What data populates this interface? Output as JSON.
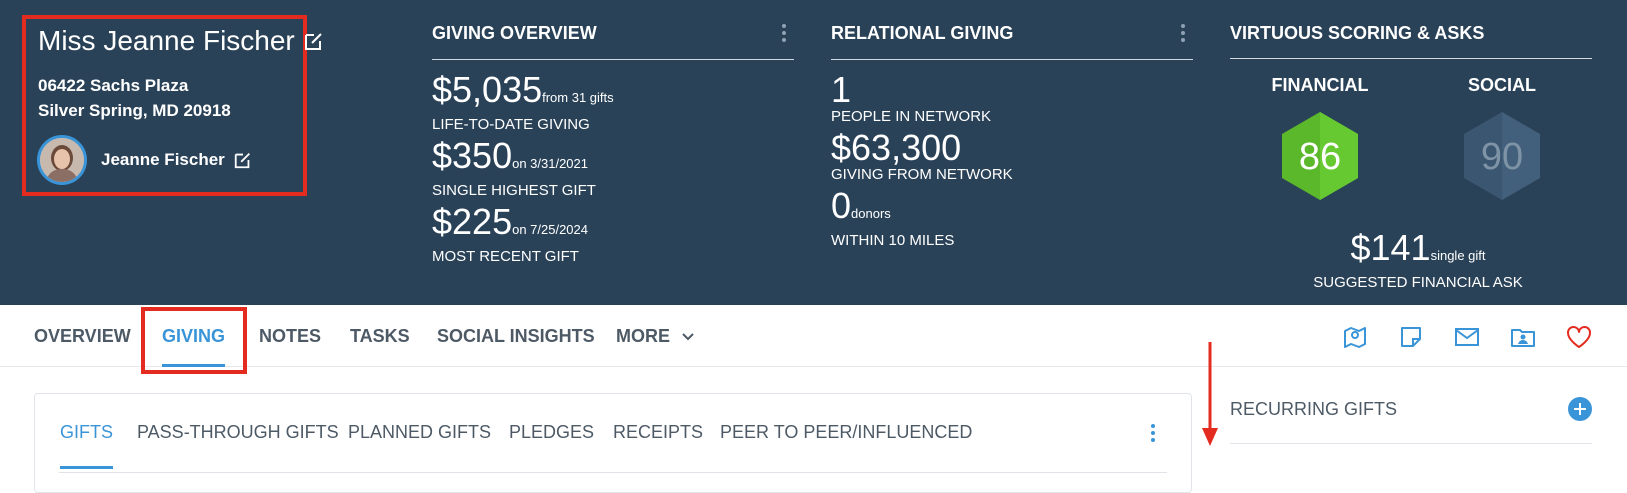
{
  "contact": {
    "name": "Miss Jeanne Fischer",
    "address_line1": "06422 Sachs Plaza",
    "address_line2": "Silver Spring, MD 20918",
    "person_name": "Jeanne Fischer"
  },
  "giving_overview": {
    "title": "GIVING OVERVIEW",
    "lifetime_value": "$5,035",
    "lifetime_note": "from 31 gifts",
    "lifetime_label": "LIFE-TO-DATE GIVING",
    "highest_value": "$350",
    "highest_note": "on 3/31/2021",
    "highest_label": "SINGLE HIGHEST GIFT",
    "recent_value": "$225",
    "recent_note": "on 7/25/2024",
    "recent_label": "MOST RECENT GIFT"
  },
  "relational_giving": {
    "title": "RELATIONAL GIVING",
    "network_value": "1",
    "network_label": "PEOPLE IN NETWORK",
    "from_network_value": "$63,300",
    "from_network_label": "GIVING FROM NETWORK",
    "donors_value": "0",
    "donors_note": "donors",
    "donors_label": "WITHIN 10 MILES"
  },
  "scoring": {
    "title": "VIRTUOUS SCORING & ASKS",
    "financial_label": "FINANCIAL",
    "financial_score": "86",
    "social_label": "SOCIAL",
    "social_score": "90",
    "ask_value": "$141",
    "ask_note": "single gift",
    "ask_label": "SUGGESTED FINANCIAL ASK",
    "colors": {
      "financial": "#5cb82b",
      "social": "#3e5a74"
    }
  },
  "nav": {
    "tabs": [
      "OVERVIEW",
      "GIVING",
      "NOTES",
      "TASKS",
      "SOCIAL INSIGHTS",
      "MORE"
    ],
    "active": "GIVING",
    "icons": [
      "map-pin-icon",
      "sticky-note-icon",
      "mail-icon",
      "contact-folder-icon",
      "heart-icon"
    ]
  },
  "giving_card": {
    "subtabs": [
      "GIFTS",
      "PASS-THROUGH GIFTS",
      "PLANNED GIFTS",
      "PLEDGES",
      "RECEIPTS",
      "PEER TO PEER/INFLUENCED"
    ],
    "active": "GIFTS"
  },
  "recurring": {
    "title": "RECURRING GIFTS"
  },
  "colors": {
    "header_bg": "#2a4258",
    "accent": "#3a95d8",
    "highlight": "#e42b1f"
  }
}
